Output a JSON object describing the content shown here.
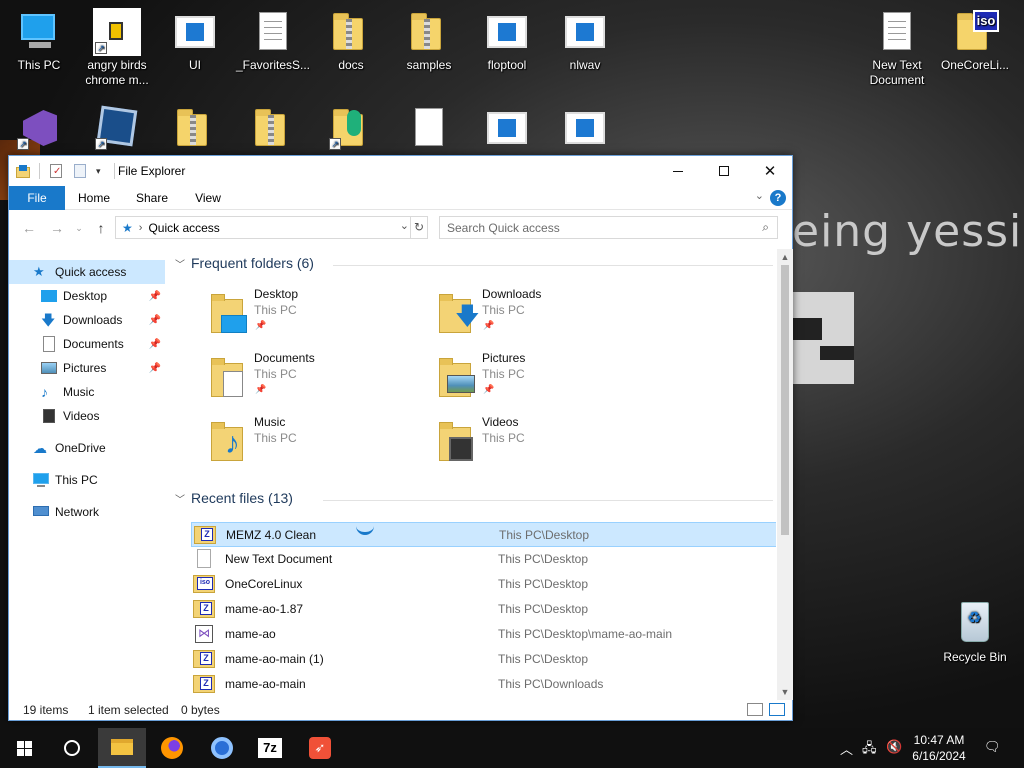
{
  "desktop": {
    "wallpaper_text": "eing yessir",
    "icons": {
      "this_pc": "This PC",
      "angry_birds": "angry birds chrome m...",
      "ui": "UI",
      "favorites": "_FavoritesS...",
      "docs": "docs",
      "samples": "samples",
      "floptool": "floptool",
      "nlwav": "nlwav",
      "new_text_document": "New Text Document",
      "onecore": "OneCoreLi...",
      "recycle_bin": "Recycle Bin"
    },
    "iso_badge": "iso"
  },
  "explorer": {
    "title": "File Explorer",
    "ribbon": {
      "file": "File",
      "home": "Home",
      "share": "Share",
      "view": "View",
      "help": "?"
    },
    "address": {
      "path": "Quick access",
      "search_placeholder": "Search Quick access"
    },
    "nav": {
      "quick_access": "Quick access",
      "desktop": "Desktop",
      "downloads": "Downloads",
      "documents": "Documents",
      "pictures": "Pictures",
      "music": "Music",
      "videos": "Videos",
      "onedrive": "OneDrive",
      "this_pc": "This PC",
      "network": "Network"
    },
    "frequent": {
      "header": "Frequent folders (6)",
      "folders": [
        {
          "name": "Desktop",
          "location": "This PC"
        },
        {
          "name": "Downloads",
          "location": "This PC"
        },
        {
          "name": "Documents",
          "location": "This PC"
        },
        {
          "name": "Pictures",
          "location": "This PC"
        },
        {
          "name": "Music",
          "location": "This PC"
        },
        {
          "name": "Videos",
          "location": "This PC"
        }
      ]
    },
    "recent": {
      "header": "Recent files (13)",
      "files": [
        {
          "name": "MEMZ 4.0 Clean",
          "path": "This PC\\Desktop"
        },
        {
          "name": "New Text Document",
          "path": "This PC\\Desktop"
        },
        {
          "name": "OneCoreLinux",
          "path": "This PC\\Desktop"
        },
        {
          "name": "mame-ao-1.87",
          "path": "This PC\\Desktop"
        },
        {
          "name": "mame-ao",
          "path": "This PC\\Desktop\\mame-ao-main"
        },
        {
          "name": "mame-ao-main (1)",
          "path": "This PC\\Desktop"
        },
        {
          "name": "mame-ao-main",
          "path": "This PC\\Downloads"
        }
      ]
    },
    "status": {
      "items": "19 items",
      "selected": "1 item selected",
      "size": "0 bytes"
    }
  },
  "taskbar": {
    "time": "10:47 AM",
    "date": "6/16/2024",
    "seven_zip": "7z"
  }
}
